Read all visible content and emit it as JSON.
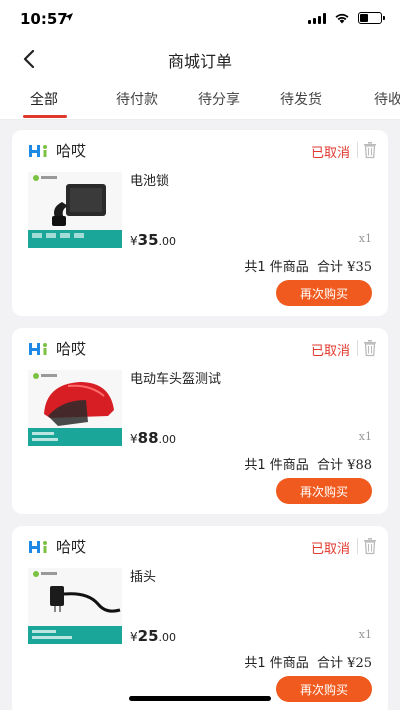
{
  "status_bar": {
    "time": "10:57"
  },
  "nav": {
    "title": "商城订单"
  },
  "tabs": [
    {
      "label": "全部",
      "active": true
    },
    {
      "label": "待付款",
      "active": false
    },
    {
      "label": "待分享",
      "active": false
    },
    {
      "label": "待发货",
      "active": false
    },
    {
      "label": "待收",
      "active": false
    }
  ],
  "orders": [
    {
      "shop_name": "哈哎",
      "status": "已取消",
      "product_name": "电池锁",
      "price_currency": "¥",
      "price_int": "35",
      "price_dec": ".00",
      "quantity": "x1",
      "summary_count": "共1 件商品",
      "summary_total_label": "合计",
      "summary_total": "¥35",
      "button_label": "再次购买"
    },
    {
      "shop_name": "哈哎",
      "status": "已取消",
      "product_name": "电动车头盔测试",
      "price_currency": "¥",
      "price_int": "88",
      "price_dec": ".00",
      "quantity": "x1",
      "summary_count": "共1 件商品",
      "summary_total_label": "合计",
      "summary_total": "¥88",
      "button_label": "再次购买"
    },
    {
      "shop_name": "哈哎",
      "status": "已取消",
      "product_name": "插头",
      "price_currency": "¥",
      "price_int": "25",
      "price_dec": ".00",
      "quantity": "x1",
      "summary_count": "共1 件商品",
      "summary_total_label": "合计",
      "summary_total": "¥25",
      "button_label": "再次购买"
    }
  ],
  "colors": {
    "accent_red": "#e0382d",
    "button_orange": "#f05a1e",
    "background": "#f2f2f4"
  }
}
